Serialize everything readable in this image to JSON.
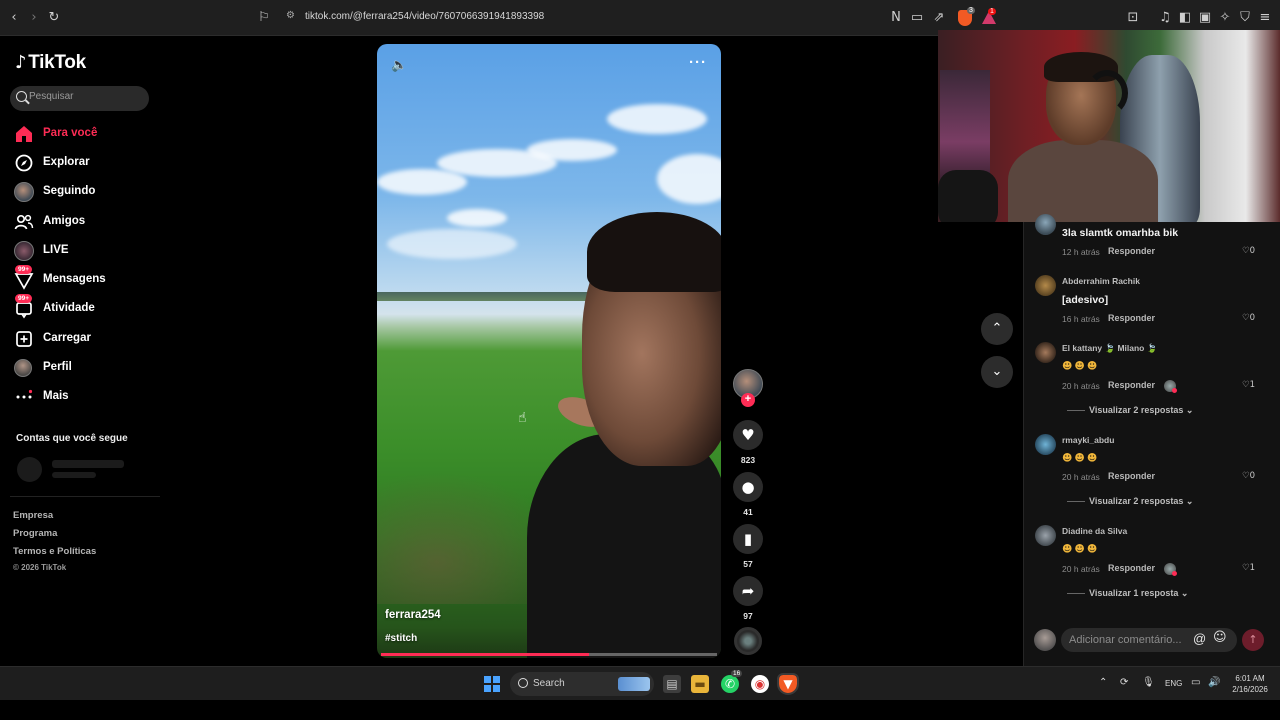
{
  "browser": {
    "url": "tiktok.com/@ferrara254/video/7607066391941893398",
    "brave_count": "3",
    "alert_count": "1"
  },
  "sidebar": {
    "logo": "TikTok",
    "search_placeholder": "Pesquisar",
    "nav": [
      {
        "label": "Para você",
        "icon": "home-icon",
        "active": true
      },
      {
        "label": "Explorar",
        "icon": "compass-icon"
      },
      {
        "label": "Seguindo",
        "icon": "avatar-icon"
      },
      {
        "label": "Amigos",
        "icon": "friends-icon"
      },
      {
        "label": "LIVE",
        "icon": "live-avatar-icon"
      },
      {
        "label": "Mensagens",
        "icon": "messages-icon",
        "badge": "99+"
      },
      {
        "label": "Atividade",
        "icon": "activity-icon",
        "badge": "99+"
      },
      {
        "label": "Carregar",
        "icon": "upload-icon"
      },
      {
        "label": "Perfil",
        "icon": "profile-avatar-icon"
      },
      {
        "label": "Mais",
        "icon": "more-icon"
      }
    ],
    "following_title": "Contas que você segue",
    "footer": {
      "company": "Empresa",
      "program": "Programa",
      "terms": "Termos e Políticas",
      "copyright": "© 2026 TikTok"
    }
  },
  "video": {
    "username": "ferrara254",
    "hashtag": "#stitch",
    "more": "···",
    "progress": 0.62
  },
  "actions": {
    "likes": "823",
    "comments": "41",
    "saves": "57",
    "shares": "97"
  },
  "comments": {
    "items": [
      {
        "name": "",
        "text": "3la slamtk omarhba bik",
        "time": "12 h atrás",
        "reply": "Responder",
        "likes": "0"
      },
      {
        "name": "Abderrahim Rachik",
        "text": "[adesivo]",
        "time": "16 h atrás",
        "reply": "Responder",
        "likes": "0"
      },
      {
        "name": "El kattany 🍃 Milano 🍃",
        "emoji": "☻☻☻",
        "time": "20 h atrás",
        "reply": "Responder",
        "likes": "1",
        "view": "Visualizar 2 respostas"
      },
      {
        "name": "rmayki_abdu",
        "emoji": "☻☻☻",
        "time": "20 h atrás",
        "reply": "Responder",
        "likes": "0",
        "view": "Visualizar 2 respostas"
      },
      {
        "name": "Diadine da Silva",
        "emoji": "☻☻☻",
        "time": "20 h atrás",
        "reply": "Responder",
        "likes": "1",
        "view": "Visualizar 1 resposta"
      }
    ],
    "input_placeholder": "Adicionar comentário...",
    "at_symbol": "@"
  },
  "taskbar": {
    "search_label": "Search",
    "whatsapp_badge": "16",
    "lang": "ENG",
    "time": "6:01 AM",
    "date": "2/16/2026"
  }
}
